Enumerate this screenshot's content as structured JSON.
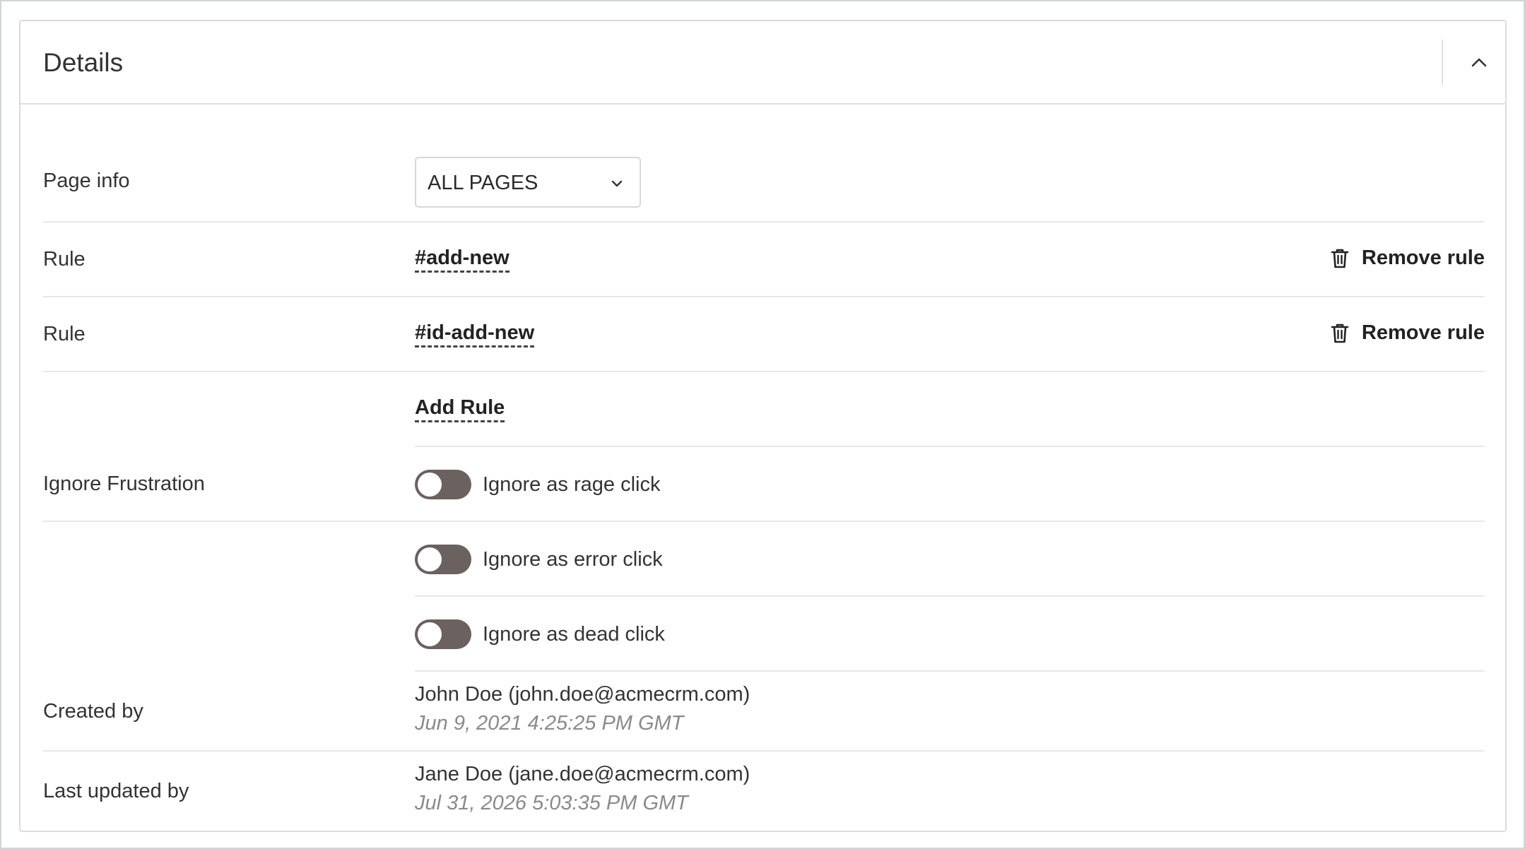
{
  "panel": {
    "title": "Details"
  },
  "page_info": {
    "label": "Page info",
    "selected": "ALL PAGES"
  },
  "rules": [
    {
      "label": "Rule",
      "value": "#add-new",
      "remove_label": "Remove rule"
    },
    {
      "label": "Rule",
      "value": "#id-add-new",
      "remove_label": "Remove rule"
    }
  ],
  "add_rule_label": "Add Rule",
  "frustration": {
    "label": "Ignore Frustration",
    "toggles": [
      {
        "label": "Ignore as rage click",
        "on": false
      },
      {
        "label": "Ignore as error click",
        "on": false
      },
      {
        "label": "Ignore as dead click",
        "on": false
      }
    ]
  },
  "created": {
    "label": "Created by",
    "name": "John Doe (john.doe@acmecrm.com)",
    "date": "Jun 9, 2021 4:25:25 PM GMT"
  },
  "updated": {
    "label": "Last updated by",
    "name": "Jane Doe (jane.doe@acmecrm.com)",
    "date": "Jul 31, 2026 5:03:35 PM GMT"
  },
  "icons": {
    "collapse": "chevron-up-icon",
    "select": "chevron-down-icon",
    "remove": "trash-icon"
  },
  "colors": {
    "toggle_off": "#6b615f",
    "border": "#dcdcdc",
    "muted_text": "#8a8a8a"
  }
}
